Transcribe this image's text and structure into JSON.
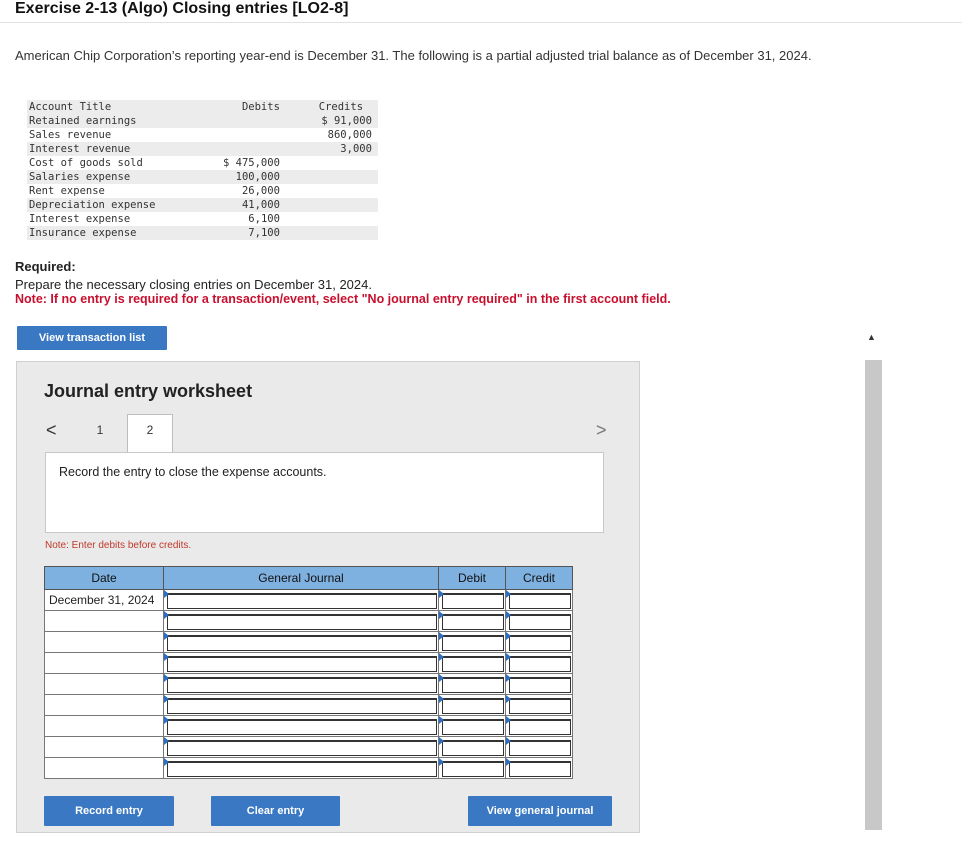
{
  "header": {
    "title": "Exercise 2-13 (Algo) Closing entries [LO2-8]",
    "intro": "American Chip Corporation’s reporting year-end is December 31. The following is a partial adjusted trial balance as of December 31, 2024."
  },
  "trial_balance": {
    "headers": {
      "account": "Account Title",
      "debits": "Debits",
      "credits": "Credits"
    },
    "rows": [
      {
        "account": "Retained earnings",
        "debit": "",
        "credit": "$ 91,000"
      },
      {
        "account": "Sales revenue",
        "debit": "",
        "credit": "860,000"
      },
      {
        "account": "Interest revenue",
        "debit": "",
        "credit": "3,000"
      },
      {
        "account": "Cost of goods sold",
        "debit": "$ 475,000",
        "credit": ""
      },
      {
        "account": "Salaries expense",
        "debit": "100,000",
        "credit": ""
      },
      {
        "account": "Rent expense",
        "debit": "26,000",
        "credit": ""
      },
      {
        "account": "Depreciation expense",
        "debit": "41,000",
        "credit": ""
      },
      {
        "account": "Interest expense",
        "debit": "6,100",
        "credit": ""
      },
      {
        "account": "Insurance expense",
        "debit": "7,100",
        "credit": ""
      }
    ]
  },
  "required": {
    "heading": "Required:",
    "text": "Prepare the necessary closing entries on December 31, 2024.",
    "note": "Note: If no entry is required for a transaction/event, select \"No journal entry required\" in the first account field."
  },
  "buttons": {
    "view_transaction_list": "View transaction list",
    "record_entry": "Record entry",
    "clear_entry": "Clear entry",
    "view_general_journal": "View general journal"
  },
  "worksheet": {
    "title": "Journal entry worksheet",
    "tabs": [
      "1",
      "2"
    ],
    "active_tab": "2",
    "nav_prev": "<",
    "nav_next": ">",
    "description": "Record the entry to close the expense accounts.",
    "note": "Note: Enter debits before credits.",
    "columns": {
      "date": "Date",
      "journal": "General Journal",
      "debit": "Debit",
      "credit": "Credit"
    },
    "first_date": "December 31, 2024"
  },
  "icons": {
    "prev": "chevron-left-icon",
    "next": "chevron-right-icon",
    "scroll_up": "triangle-up-icon"
  },
  "colors": {
    "button": "#3b78c3",
    "table_header": "#7fb1e0",
    "note_red": "#c8102e"
  }
}
